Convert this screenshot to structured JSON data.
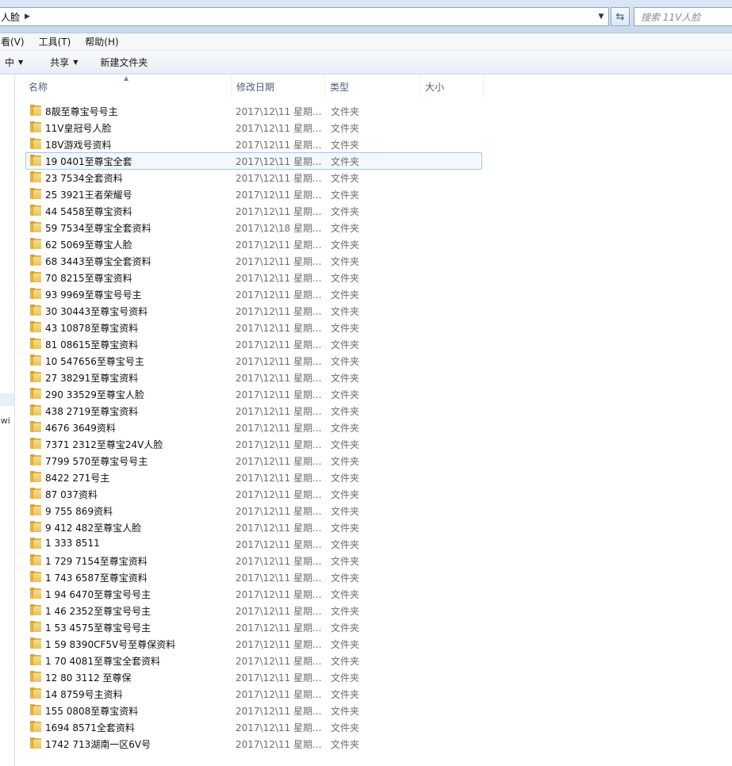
{
  "address_bar": {
    "path_fragment": "人脸",
    "search_placeholder": "搜索 11V人脸"
  },
  "menu": [
    "查看(V)",
    "工具(T)",
    "帮助(H)"
  ],
  "menu_visible": [
    "看(V)",
    "工具(T)",
    "帮助(H)"
  ],
  "commands": {
    "organize_tail": "中",
    "share": "共享",
    "new_folder": "新建文件夹"
  },
  "nav": {
    "item_fragment": "owi"
  },
  "columns": {
    "name": "名称",
    "date": "修改日期",
    "type": "类型",
    "size": "大小"
  },
  "rows": [
    {
      "name": "8靓至尊宝号号主",
      "date": "2017\\12\\11 星期...",
      "type": "文件夹"
    },
    {
      "name": "11V皇冠号人脸",
      "date": "2017\\12\\11 星期...",
      "type": "文件夹"
    },
    {
      "name": "18V游戏号资料",
      "date": "2017\\12\\11 星期...",
      "type": "文件夹"
    },
    {
      "name": "19  0401至尊宝全套",
      "date": "2017\\12\\11 星期...",
      "type": "文件夹",
      "selected": true
    },
    {
      "name": "23  7534全套资料",
      "date": "2017\\12\\11 星期...",
      "type": "文件夹"
    },
    {
      "name": "25  3921王者荣耀号",
      "date": "2017\\12\\11 星期...",
      "type": "文件夹"
    },
    {
      "name": "44  5458至尊宝资料",
      "date": "2017\\12\\11 星期...",
      "type": "文件夹"
    },
    {
      "name": "59  7534至尊宝全套资料",
      "date": "2017\\12\\18 星期...",
      "type": "文件夹"
    },
    {
      "name": "62  5069至尊宝人脸",
      "date": "2017\\12\\11 星期...",
      "type": "文件夹"
    },
    {
      "name": "68  3443至尊宝全套资料",
      "date": "2017\\12\\11 星期...",
      "type": "文件夹"
    },
    {
      "name": "70  8215至尊宝资料",
      "date": "2017\\12\\11 星期...",
      "type": "文件夹"
    },
    {
      "name": "93  9969至尊宝号号主",
      "date": "2017\\12\\11 星期...",
      "type": "文件夹"
    },
    {
      "name": "30  30443至尊宝号资料",
      "date": "2017\\12\\11 星期...",
      "type": "文件夹"
    },
    {
      "name": "43  10878至尊宝资料",
      "date": "2017\\12\\11 星期...",
      "type": "文件夹"
    },
    {
      "name": "81  08615至尊宝资料",
      "date": "2017\\12\\11 星期...",
      "type": "文件夹"
    },
    {
      "name": "10  547656至尊宝号主",
      "date": "2017\\12\\11 星期...",
      "type": "文件夹"
    },
    {
      "name": "27  38291至尊宝资料",
      "date": "2017\\12\\11 星期...",
      "type": "文件夹"
    },
    {
      "name": "290  33529至尊宝人脸",
      "date": "2017\\12\\11 星期...",
      "type": "文件夹"
    },
    {
      "name": "438  2719至尊宝资料",
      "date": "2017\\12\\11 星期...",
      "type": "文件夹"
    },
    {
      "name": "4676  3649资料",
      "date": "2017\\12\\11 星期...",
      "type": "文件夹"
    },
    {
      "name": "7371  2312至尊宝24V人脸",
      "date": "2017\\12\\11 星期...",
      "type": "文件夹"
    },
    {
      "name": "7799  570至尊宝号号主",
      "date": "2017\\12\\11 星期...",
      "type": "文件夹"
    },
    {
      "name": "8422  271号主",
      "date": "2017\\12\\11 星期...",
      "type": "文件夹"
    },
    {
      "name": "87  037资料",
      "date": "2017\\12\\11 星期...",
      "type": "文件夹"
    },
    {
      "name": "9  755  869资料",
      "date": "2017\\12\\11 星期...",
      "type": "文件夹"
    },
    {
      "name": "9  412  482至尊宝人脸",
      "date": "2017\\12\\11 星期...",
      "type": "文件夹"
    },
    {
      "name": "1  333  8511",
      "date": "2017\\12\\11 星期...",
      "type": "文件夹"
    },
    {
      "name": "1  729  7154至尊宝资料",
      "date": "2017\\12\\11 星期...",
      "type": "文件夹"
    },
    {
      "name": "1  743  6587至尊宝资料",
      "date": "2017\\12\\11 星期...",
      "type": "文件夹"
    },
    {
      "name": "1  94  6470至尊宝号号主",
      "date": "2017\\12\\11 星期...",
      "type": "文件夹"
    },
    {
      "name": "1  46  2352至尊宝号号主",
      "date": "2017\\12\\11 星期...",
      "type": "文件夹"
    },
    {
      "name": "1  53  4575至尊宝号号主",
      "date": "2017\\12\\11 星期...",
      "type": "文件夹"
    },
    {
      "name": "1  59  8390CF5V号至尊保资料",
      "date": "2017\\12\\11 星期...",
      "type": "文件夹"
    },
    {
      "name": "1  70  4081至尊宝全套资料",
      "date": "2017\\12\\11 星期...",
      "type": "文件夹"
    },
    {
      "name": "12  80  3112 至尊保",
      "date": "2017\\12\\11 星期...",
      "type": "文件夹"
    },
    {
      "name": "14  8759号主资料",
      "date": "2017\\12\\11 星期...",
      "type": "文件夹"
    },
    {
      "name": "155  0808至尊宝资料",
      "date": "2017\\12\\11 星期...",
      "type": "文件夹"
    },
    {
      "name": "1694  8571全套资料",
      "date": "2017\\12\\11 星期...",
      "type": "文件夹"
    },
    {
      "name": "1742  713湖南一区6V号",
      "date": "2017\\12\\11 星期...",
      "type": "文件夹"
    }
  ]
}
